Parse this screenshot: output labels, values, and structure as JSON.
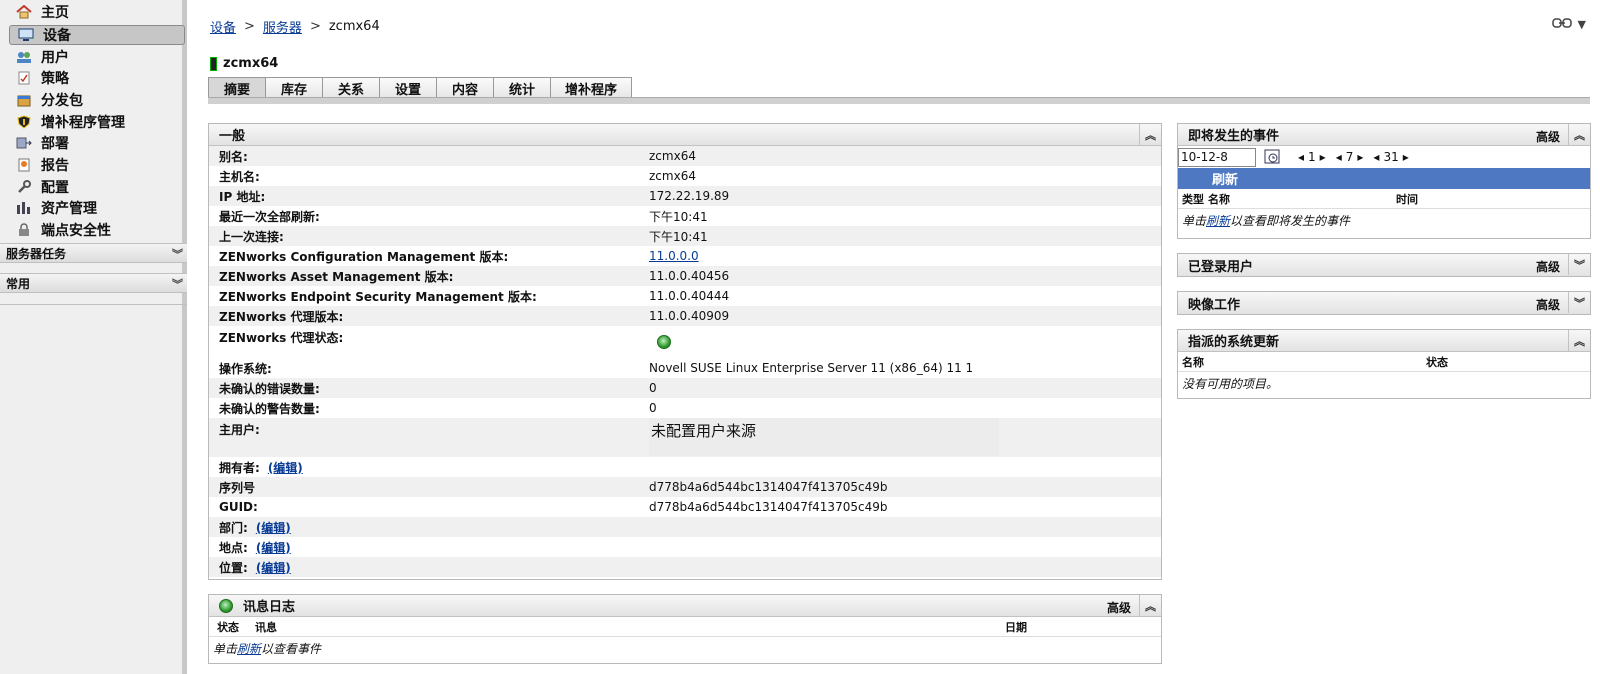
{
  "sidebar": {
    "items": [
      {
        "label": "主页",
        "icon": "home-icon"
      },
      {
        "label": "设备",
        "icon": "monitor-icon"
      },
      {
        "label": "用户",
        "icon": "users-icon"
      },
      {
        "label": "策略",
        "icon": "policy-icon"
      },
      {
        "label": "分发包",
        "icon": "bundle-icon"
      },
      {
        "label": "增补程序管理",
        "icon": "patch-shield-icon"
      },
      {
        "label": "部署",
        "icon": "deployment-icon"
      },
      {
        "label": "报告",
        "icon": "report-icon"
      },
      {
        "label": "配置",
        "icon": "wrench-icon"
      },
      {
        "label": "资产管理",
        "icon": "asset-icon"
      },
      {
        "label": "端点安全性",
        "icon": "lock-icon"
      }
    ],
    "sections": [
      {
        "label": "服务器任务"
      },
      {
        "label": "常用"
      }
    ]
  },
  "breadcrumb": {
    "items": [
      "设备",
      "服务器",
      "zcmx64"
    ],
    "separator": ">"
  },
  "device": {
    "name": "zcmx64"
  },
  "tabs": [
    "摘要",
    "库存",
    "关系",
    "设置",
    "内容",
    "统计",
    "增补程序"
  ],
  "general": {
    "title": "一般",
    "rows": [
      {
        "label": "别名:",
        "value": "zcmx64"
      },
      {
        "label": "主机名:",
        "value": "zcmx64"
      },
      {
        "label": "IP 地址:",
        "value": "172.22.19.89"
      },
      {
        "label": "最近一次全部刷新:",
        "value": "下午10:41"
      },
      {
        "label": "上一次连接:",
        "value": "下午10:41"
      },
      {
        "label": "ZENworks Configuration Management 版本:",
        "value": "11.0.0.0"
      },
      {
        "label": "ZENworks Asset Management 版本:",
        "value": "11.0.0.40456"
      },
      {
        "label": "ZENworks Endpoint Security Management 版本:",
        "value": "11.0.0.40444"
      },
      {
        "label": "ZENworks 代理版本:",
        "value": "11.0.0.40909"
      },
      {
        "label": "ZENworks 代理状态:",
        "value": ""
      },
      {
        "label": "操作系统:",
        "value": "Novell SUSE Linux Enterprise Server 11 (x86_64) 11 1"
      },
      {
        "label": "未确认的错误数量:",
        "value": "0"
      },
      {
        "label": "未确认的警告数量:",
        "value": "0"
      },
      {
        "label": "主用户:",
        "value": "未配置用户来源"
      },
      {
        "label": "拥有者:",
        "value": "(编辑)"
      },
      {
        "label": "序列号",
        "value": "d778b4a6d544bc1314047f413705c49b"
      },
      {
        "label": "GUID:",
        "value": "d778b4a6d544bc1314047f413705c49b"
      },
      {
        "label": "部门:",
        "value": "(编辑)"
      },
      {
        "label": "地点:",
        "value": "(编辑)"
      },
      {
        "label": "位置:",
        "value": "(编辑)"
      }
    ]
  },
  "message_log": {
    "title": "讯息日志",
    "advanced": "高级",
    "columns": [
      "状态",
      "讯息",
      "日期"
    ],
    "note_prefix": "单击",
    "note_link": "刷新",
    "note_suffix": "以查看事件"
  },
  "upcoming_events": {
    "title": "即将发生的事件",
    "advanced": "高级",
    "date": "10-12-8",
    "steppers": [
      "1",
      "7",
      "31"
    ],
    "refresh": "刷新",
    "columns": [
      "类型",
      "名称",
      "时间"
    ],
    "note_prefix": "单击",
    "note_link": "刷新",
    "note_suffix": "以查看即将发生的事件"
  },
  "logged_users": {
    "title": "已登录用户",
    "advanced": "高级"
  },
  "imaging_work": {
    "title": "映像工作",
    "advanced": "高级"
  },
  "system_updates": {
    "title": "指派的系统更新",
    "columns": [
      "名称",
      "状态"
    ],
    "note": "没有可用的项目。"
  }
}
